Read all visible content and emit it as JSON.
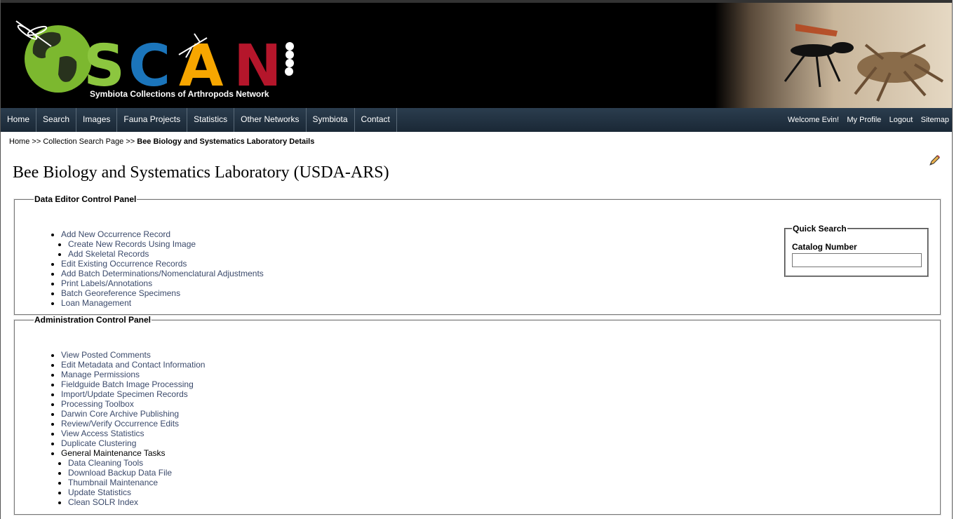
{
  "header": {
    "logo_text": "SCAN",
    "logo_subtitle": "Symbiota Collections of Arthropods Network"
  },
  "nav": {
    "items": [
      "Home",
      "Search",
      "Images",
      "Fauna Projects",
      "Statistics",
      "Other Networks",
      "Symbiota",
      "Contact"
    ],
    "welcome": "Welcome Evin!",
    "my_profile": "My Profile",
    "logout": "Logout",
    "sitemap": "Sitemap"
  },
  "breadcrumb": {
    "home": "Home",
    "sep1": " >> ",
    "search_page": "Collection Search Page",
    "sep2": " >> ",
    "current": "Bee Biology and Systematics Laboratory Details"
  },
  "page": {
    "title": "Bee Biology and Systematics Laboratory (USDA-ARS)"
  },
  "editor_panel": {
    "legend": "Data Editor Control Panel",
    "items": [
      {
        "label": "Add New Occurrence Record",
        "sub": false
      },
      {
        "label": "Create New Records Using Image",
        "sub": true
      },
      {
        "label": "Add Skeletal Records",
        "sub": true
      },
      {
        "label": "Edit Existing Occurrence Records",
        "sub": false
      },
      {
        "label": "Add Batch Determinations/Nomenclatural Adjustments",
        "sub": false
      },
      {
        "label": "Print Labels/Annotations",
        "sub": false
      },
      {
        "label": "Batch Georeference Specimens",
        "sub": false
      },
      {
        "label": "Loan Management",
        "sub": false
      }
    ]
  },
  "quick_search": {
    "legend": "Quick Search",
    "label": "Catalog Number",
    "value": ""
  },
  "admin_panel": {
    "legend": "Administration Control Panel",
    "items": [
      {
        "label": "View Posted Comments",
        "sub": false,
        "link": true
      },
      {
        "label": "Edit Metadata and Contact Information",
        "sub": false,
        "link": true
      },
      {
        "label": "Manage Permissions",
        "sub": false,
        "link": true
      },
      {
        "label": "Fieldguide Batch Image Processing",
        "sub": false,
        "link": true
      },
      {
        "label": "Import/Update Specimen Records",
        "sub": false,
        "link": true
      },
      {
        "label": "Processing Toolbox",
        "sub": false,
        "link": true
      },
      {
        "label": "Darwin Core Archive Publishing",
        "sub": false,
        "link": true
      },
      {
        "label": "Review/Verify Occurrence Edits",
        "sub": false,
        "link": true
      },
      {
        "label": "View Access Statistics",
        "sub": false,
        "link": true
      },
      {
        "label": "Duplicate Clustering",
        "sub": false,
        "link": true
      },
      {
        "label": "General Maintenance Tasks",
        "sub": false,
        "link": false
      },
      {
        "label": "Data Cleaning Tools",
        "sub": true,
        "link": true
      },
      {
        "label": "Download Backup Data File",
        "sub": true,
        "link": true
      },
      {
        "label": "Thumbnail Maintenance",
        "sub": true,
        "link": true
      },
      {
        "label": "Update Statistics",
        "sub": true,
        "link": true
      },
      {
        "label": "Clean SOLR Index",
        "sub": true,
        "link": true
      }
    ]
  },
  "colors": {
    "link": "#3b4a6b",
    "navbar": "#1f2f3e",
    "logo_green": "#8cc63f",
    "logo_blue": "#1b75bb",
    "logo_orange": "#f7a600",
    "logo_red": "#b5162b"
  }
}
